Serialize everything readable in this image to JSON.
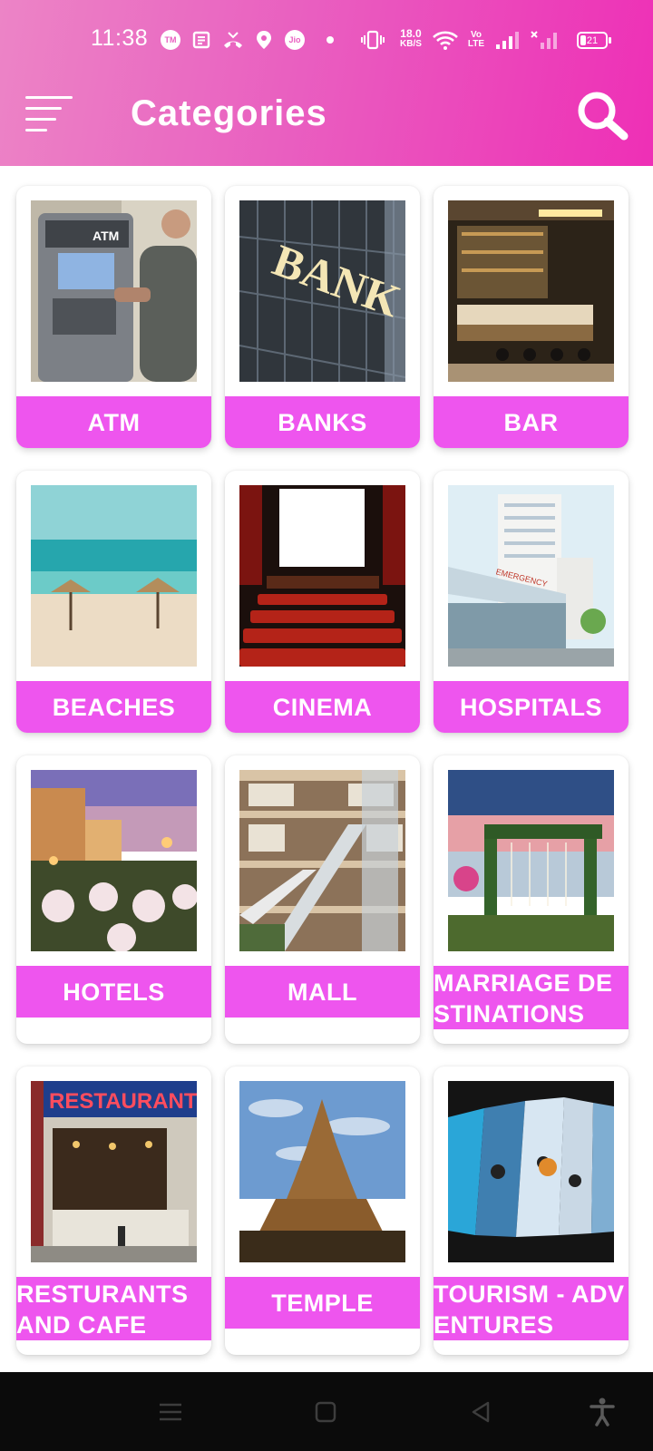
{
  "status_bar": {
    "time": "11:38",
    "icons": [
      "tm-icon",
      "news-icon",
      "missed-call-icon",
      "location-pin-icon",
      "jio-icon",
      "dot-icon",
      "vibrate-icon",
      "wifi-icon",
      "volte-icon",
      "signal-icon",
      "signal-no-service-icon",
      "battery-icon"
    ],
    "jio_label": "Jio",
    "tm_label": "TM",
    "network_speed_value": "18.0",
    "network_speed_unit": "KB/S",
    "volte_label": "Vo LTE",
    "battery_level": "21"
  },
  "app_bar": {
    "title": "Categories",
    "menu_icon": "hamburger-menu-icon",
    "search_icon": "search-icon"
  },
  "categories": [
    {
      "label": "ATM",
      "icon": "atm-photo"
    },
    {
      "label": "BANKS",
      "icon": "bank-photo"
    },
    {
      "label": "BAR",
      "icon": "bar-photo"
    },
    {
      "label": "BEACHES",
      "icon": "beach-photo"
    },
    {
      "label": "CINEMA",
      "icon": "cinema-photo"
    },
    {
      "label": "HOSPITALS",
      "icon": "hospital-photo"
    },
    {
      "label": "HOTELS",
      "icon": "hotel-photo"
    },
    {
      "label": "MALL",
      "icon": "mall-photo"
    },
    {
      "label": "MARRIAGE DESTINATIONS",
      "icon": "wedding-venue-photo"
    },
    {
      "label": "RESTURANTS AND CAFE",
      "icon": "restaurant-photo"
    },
    {
      "label": "TEMPLE",
      "icon": "temple-photo"
    },
    {
      "label": "TOURISM - ADVENTURES",
      "icon": "adventure-photo"
    }
  ],
  "nav_bar": {
    "items": [
      "recents-menu-icon",
      "home-square-icon",
      "back-triangle-icon",
      "accessibility-icon"
    ]
  },
  "colors": {
    "header_gradient_start": "#ec84c6",
    "header_gradient_end": "#ee2fb6",
    "label_background": "#ee55ee",
    "nav_background": "#0b0b0b"
  }
}
